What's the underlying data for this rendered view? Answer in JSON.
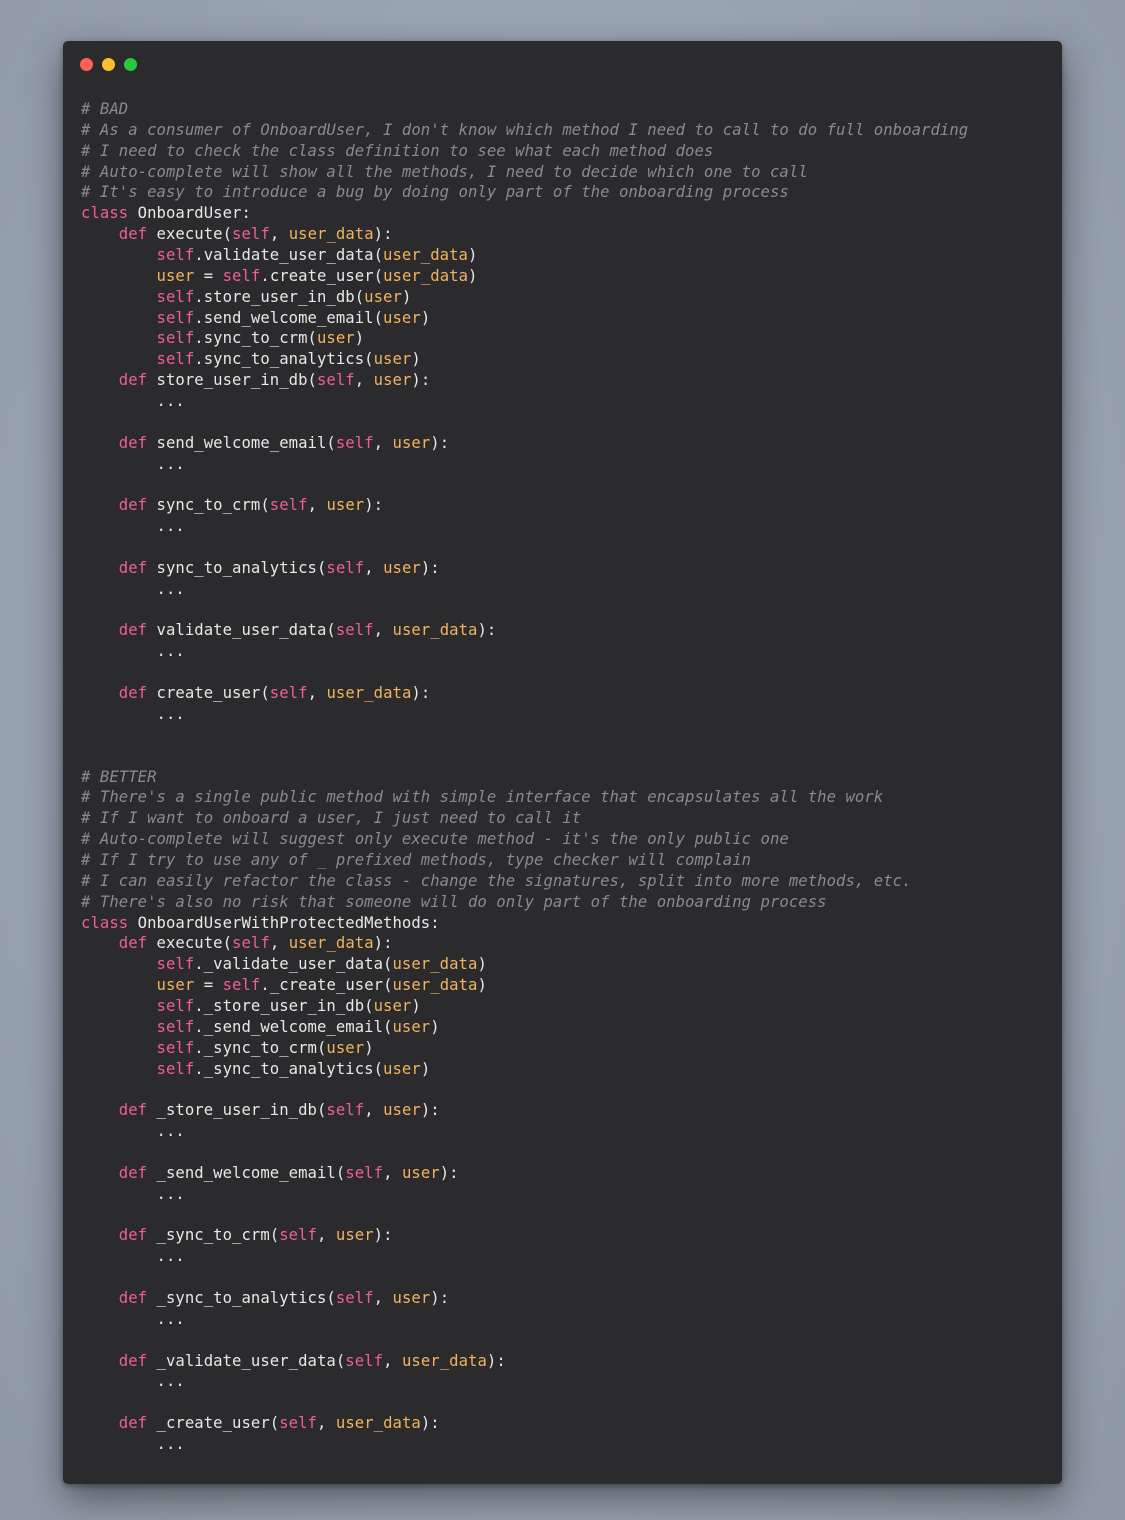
{
  "window": {
    "title": "",
    "controls": [
      "close",
      "minimize",
      "zoom"
    ],
    "colors": {
      "background": "#2b2b2e",
      "close": "#ff5f57",
      "minimize": "#febc2e",
      "zoom": "#28c840",
      "comment": "#8a8a8f",
      "keyword": "#ef5f92",
      "parameter": "#f2b35e",
      "text": "#e8e8e8"
    }
  },
  "code": {
    "language": "python",
    "lines": [
      [
        [
          "# BAD",
          "comment"
        ]
      ],
      [
        [
          "# As a consumer of OnboardUser, I don't know which method I need to call to do full onboarding",
          "comment"
        ]
      ],
      [
        [
          "# I need to check the class definition to see what each method does",
          "comment"
        ]
      ],
      [
        [
          "# Auto-complete will show all the methods, I need to decide which one to call",
          "comment"
        ]
      ],
      [
        [
          "# It's easy to introduce a bug by doing only part of the onboarding process",
          "comment"
        ]
      ],
      [
        [
          "class",
          "keyword"
        ],
        [
          " OnboardUser:",
          "name"
        ]
      ],
      [
        [
          "    ",
          "name"
        ],
        [
          "def",
          "keyword"
        ],
        [
          " execute(",
          "name"
        ],
        [
          "self",
          "self"
        ],
        [
          ", ",
          "punct"
        ],
        [
          "user_data",
          "param"
        ],
        [
          "):",
          "punct"
        ]
      ],
      [
        [
          "        ",
          "name"
        ],
        [
          "self",
          "self"
        ],
        [
          ".validate_user_data(",
          "name"
        ],
        [
          "user_data",
          "param"
        ],
        [
          ")",
          "punct"
        ]
      ],
      [
        [
          "        ",
          "name"
        ],
        [
          "user",
          "param"
        ],
        [
          " = ",
          "punct"
        ],
        [
          "self",
          "self"
        ],
        [
          ".create_user(",
          "name"
        ],
        [
          "user_data",
          "param"
        ],
        [
          ")",
          "punct"
        ]
      ],
      [
        [
          "        ",
          "name"
        ],
        [
          "self",
          "self"
        ],
        [
          ".store_user_in_db(",
          "name"
        ],
        [
          "user",
          "param"
        ],
        [
          ")",
          "punct"
        ]
      ],
      [
        [
          "        ",
          "name"
        ],
        [
          "self",
          "self"
        ],
        [
          ".send_welcome_email(",
          "name"
        ],
        [
          "user",
          "param"
        ],
        [
          ")",
          "punct"
        ]
      ],
      [
        [
          "        ",
          "name"
        ],
        [
          "self",
          "self"
        ],
        [
          ".sync_to_crm(",
          "name"
        ],
        [
          "user",
          "param"
        ],
        [
          ")",
          "punct"
        ]
      ],
      [
        [
          "        ",
          "name"
        ],
        [
          "self",
          "self"
        ],
        [
          ".sync_to_analytics(",
          "name"
        ],
        [
          "user",
          "param"
        ],
        [
          ")",
          "punct"
        ]
      ],
      [
        [
          "    ",
          "name"
        ],
        [
          "def",
          "keyword"
        ],
        [
          " store_user_in_db(",
          "name"
        ],
        [
          "self",
          "self"
        ],
        [
          ", ",
          "punct"
        ],
        [
          "user",
          "param"
        ],
        [
          "):",
          "punct"
        ]
      ],
      [
        [
          "        ...",
          "name"
        ]
      ],
      [],
      [
        [
          "    ",
          "name"
        ],
        [
          "def",
          "keyword"
        ],
        [
          " send_welcome_email(",
          "name"
        ],
        [
          "self",
          "self"
        ],
        [
          ", ",
          "punct"
        ],
        [
          "user",
          "param"
        ],
        [
          "):",
          "punct"
        ]
      ],
      [
        [
          "        ...",
          "name"
        ]
      ],
      [],
      [
        [
          "    ",
          "name"
        ],
        [
          "def",
          "keyword"
        ],
        [
          " sync_to_crm(",
          "name"
        ],
        [
          "self",
          "self"
        ],
        [
          ", ",
          "punct"
        ],
        [
          "user",
          "param"
        ],
        [
          "):",
          "punct"
        ]
      ],
      [
        [
          "        ...",
          "name"
        ]
      ],
      [],
      [
        [
          "    ",
          "name"
        ],
        [
          "def",
          "keyword"
        ],
        [
          " sync_to_analytics(",
          "name"
        ],
        [
          "self",
          "self"
        ],
        [
          ", ",
          "punct"
        ],
        [
          "user",
          "param"
        ],
        [
          "):",
          "punct"
        ]
      ],
      [
        [
          "        ...",
          "name"
        ]
      ],
      [],
      [
        [
          "    ",
          "name"
        ],
        [
          "def",
          "keyword"
        ],
        [
          " validate_user_data(",
          "name"
        ],
        [
          "self",
          "self"
        ],
        [
          ", ",
          "punct"
        ],
        [
          "user_data",
          "param"
        ],
        [
          "):",
          "punct"
        ]
      ],
      [
        [
          "        ...",
          "name"
        ]
      ],
      [],
      [
        [
          "    ",
          "name"
        ],
        [
          "def",
          "keyword"
        ],
        [
          " create_user(",
          "name"
        ],
        [
          "self",
          "self"
        ],
        [
          ", ",
          "punct"
        ],
        [
          "user_data",
          "param"
        ],
        [
          "):",
          "punct"
        ]
      ],
      [
        [
          "        ...",
          "name"
        ]
      ],
      [],
      [],
      [
        [
          "# BETTER",
          "comment"
        ]
      ],
      [
        [
          "# There's a single public method with simple interface that encapsulates all the work",
          "comment"
        ]
      ],
      [
        [
          "# If I want to onboard a user, I just need to call it",
          "comment"
        ]
      ],
      [
        [
          "# Auto-complete will suggest only execute method - it's the only public one",
          "comment"
        ]
      ],
      [
        [
          "# If I try to use any of _ prefixed methods, type checker will complain",
          "comment"
        ]
      ],
      [
        [
          "# I can easily refactor the class - change the signatures, split into more methods, etc.",
          "comment"
        ]
      ],
      [
        [
          "# There's also no risk that someone will do only part of the onboarding process",
          "comment"
        ]
      ],
      [
        [
          "class",
          "keyword"
        ],
        [
          " OnboardUserWithProtectedMethods:",
          "name"
        ]
      ],
      [
        [
          "    ",
          "name"
        ],
        [
          "def",
          "keyword"
        ],
        [
          " execute(",
          "name"
        ],
        [
          "self",
          "self"
        ],
        [
          ", ",
          "punct"
        ],
        [
          "user_data",
          "param"
        ],
        [
          "):",
          "punct"
        ]
      ],
      [
        [
          "        ",
          "name"
        ],
        [
          "self",
          "self"
        ],
        [
          "._validate_user_data(",
          "name"
        ],
        [
          "user_data",
          "param"
        ],
        [
          ")",
          "punct"
        ]
      ],
      [
        [
          "        ",
          "name"
        ],
        [
          "user",
          "param"
        ],
        [
          " = ",
          "punct"
        ],
        [
          "self",
          "self"
        ],
        [
          "._create_user(",
          "name"
        ],
        [
          "user_data",
          "param"
        ],
        [
          ")",
          "punct"
        ]
      ],
      [
        [
          "        ",
          "name"
        ],
        [
          "self",
          "self"
        ],
        [
          "._store_user_in_db(",
          "name"
        ],
        [
          "user",
          "param"
        ],
        [
          ")",
          "punct"
        ]
      ],
      [
        [
          "        ",
          "name"
        ],
        [
          "self",
          "self"
        ],
        [
          "._send_welcome_email(",
          "name"
        ],
        [
          "user",
          "param"
        ],
        [
          ")",
          "punct"
        ]
      ],
      [
        [
          "        ",
          "name"
        ],
        [
          "self",
          "self"
        ],
        [
          "._sync_to_crm(",
          "name"
        ],
        [
          "user",
          "param"
        ],
        [
          ")",
          "punct"
        ]
      ],
      [
        [
          "        ",
          "name"
        ],
        [
          "self",
          "self"
        ],
        [
          "._sync_to_analytics(",
          "name"
        ],
        [
          "user",
          "param"
        ],
        [
          ")",
          "punct"
        ]
      ],
      [],
      [
        [
          "    ",
          "name"
        ],
        [
          "def",
          "keyword"
        ],
        [
          " _store_user_in_db(",
          "name"
        ],
        [
          "self",
          "self"
        ],
        [
          ", ",
          "punct"
        ],
        [
          "user",
          "param"
        ],
        [
          "):",
          "punct"
        ]
      ],
      [
        [
          "        ...",
          "name"
        ]
      ],
      [],
      [
        [
          "    ",
          "name"
        ],
        [
          "def",
          "keyword"
        ],
        [
          " _send_welcome_email(",
          "name"
        ],
        [
          "self",
          "self"
        ],
        [
          ", ",
          "punct"
        ],
        [
          "user",
          "param"
        ],
        [
          "):",
          "punct"
        ]
      ],
      [
        [
          "        ...",
          "name"
        ]
      ],
      [],
      [
        [
          "    ",
          "name"
        ],
        [
          "def",
          "keyword"
        ],
        [
          " _sync_to_crm(",
          "name"
        ],
        [
          "self",
          "self"
        ],
        [
          ", ",
          "punct"
        ],
        [
          "user",
          "param"
        ],
        [
          "):",
          "punct"
        ]
      ],
      [
        [
          "        ...",
          "name"
        ]
      ],
      [],
      [
        [
          "    ",
          "name"
        ],
        [
          "def",
          "keyword"
        ],
        [
          " _sync_to_analytics(",
          "name"
        ],
        [
          "self",
          "self"
        ],
        [
          ", ",
          "punct"
        ],
        [
          "user",
          "param"
        ],
        [
          "):",
          "punct"
        ]
      ],
      [
        [
          "        ...",
          "name"
        ]
      ],
      [],
      [
        [
          "    ",
          "name"
        ],
        [
          "def",
          "keyword"
        ],
        [
          " _validate_user_data(",
          "name"
        ],
        [
          "self",
          "self"
        ],
        [
          ", ",
          "punct"
        ],
        [
          "user_data",
          "param"
        ],
        [
          "):",
          "punct"
        ]
      ],
      [
        [
          "        ...",
          "name"
        ]
      ],
      [],
      [
        [
          "    ",
          "name"
        ],
        [
          "def",
          "keyword"
        ],
        [
          " _create_user(",
          "name"
        ],
        [
          "self",
          "self"
        ],
        [
          ", ",
          "punct"
        ],
        [
          "user_data",
          "param"
        ],
        [
          "):",
          "punct"
        ]
      ],
      [
        [
          "        ...",
          "name"
        ]
      ]
    ]
  }
}
